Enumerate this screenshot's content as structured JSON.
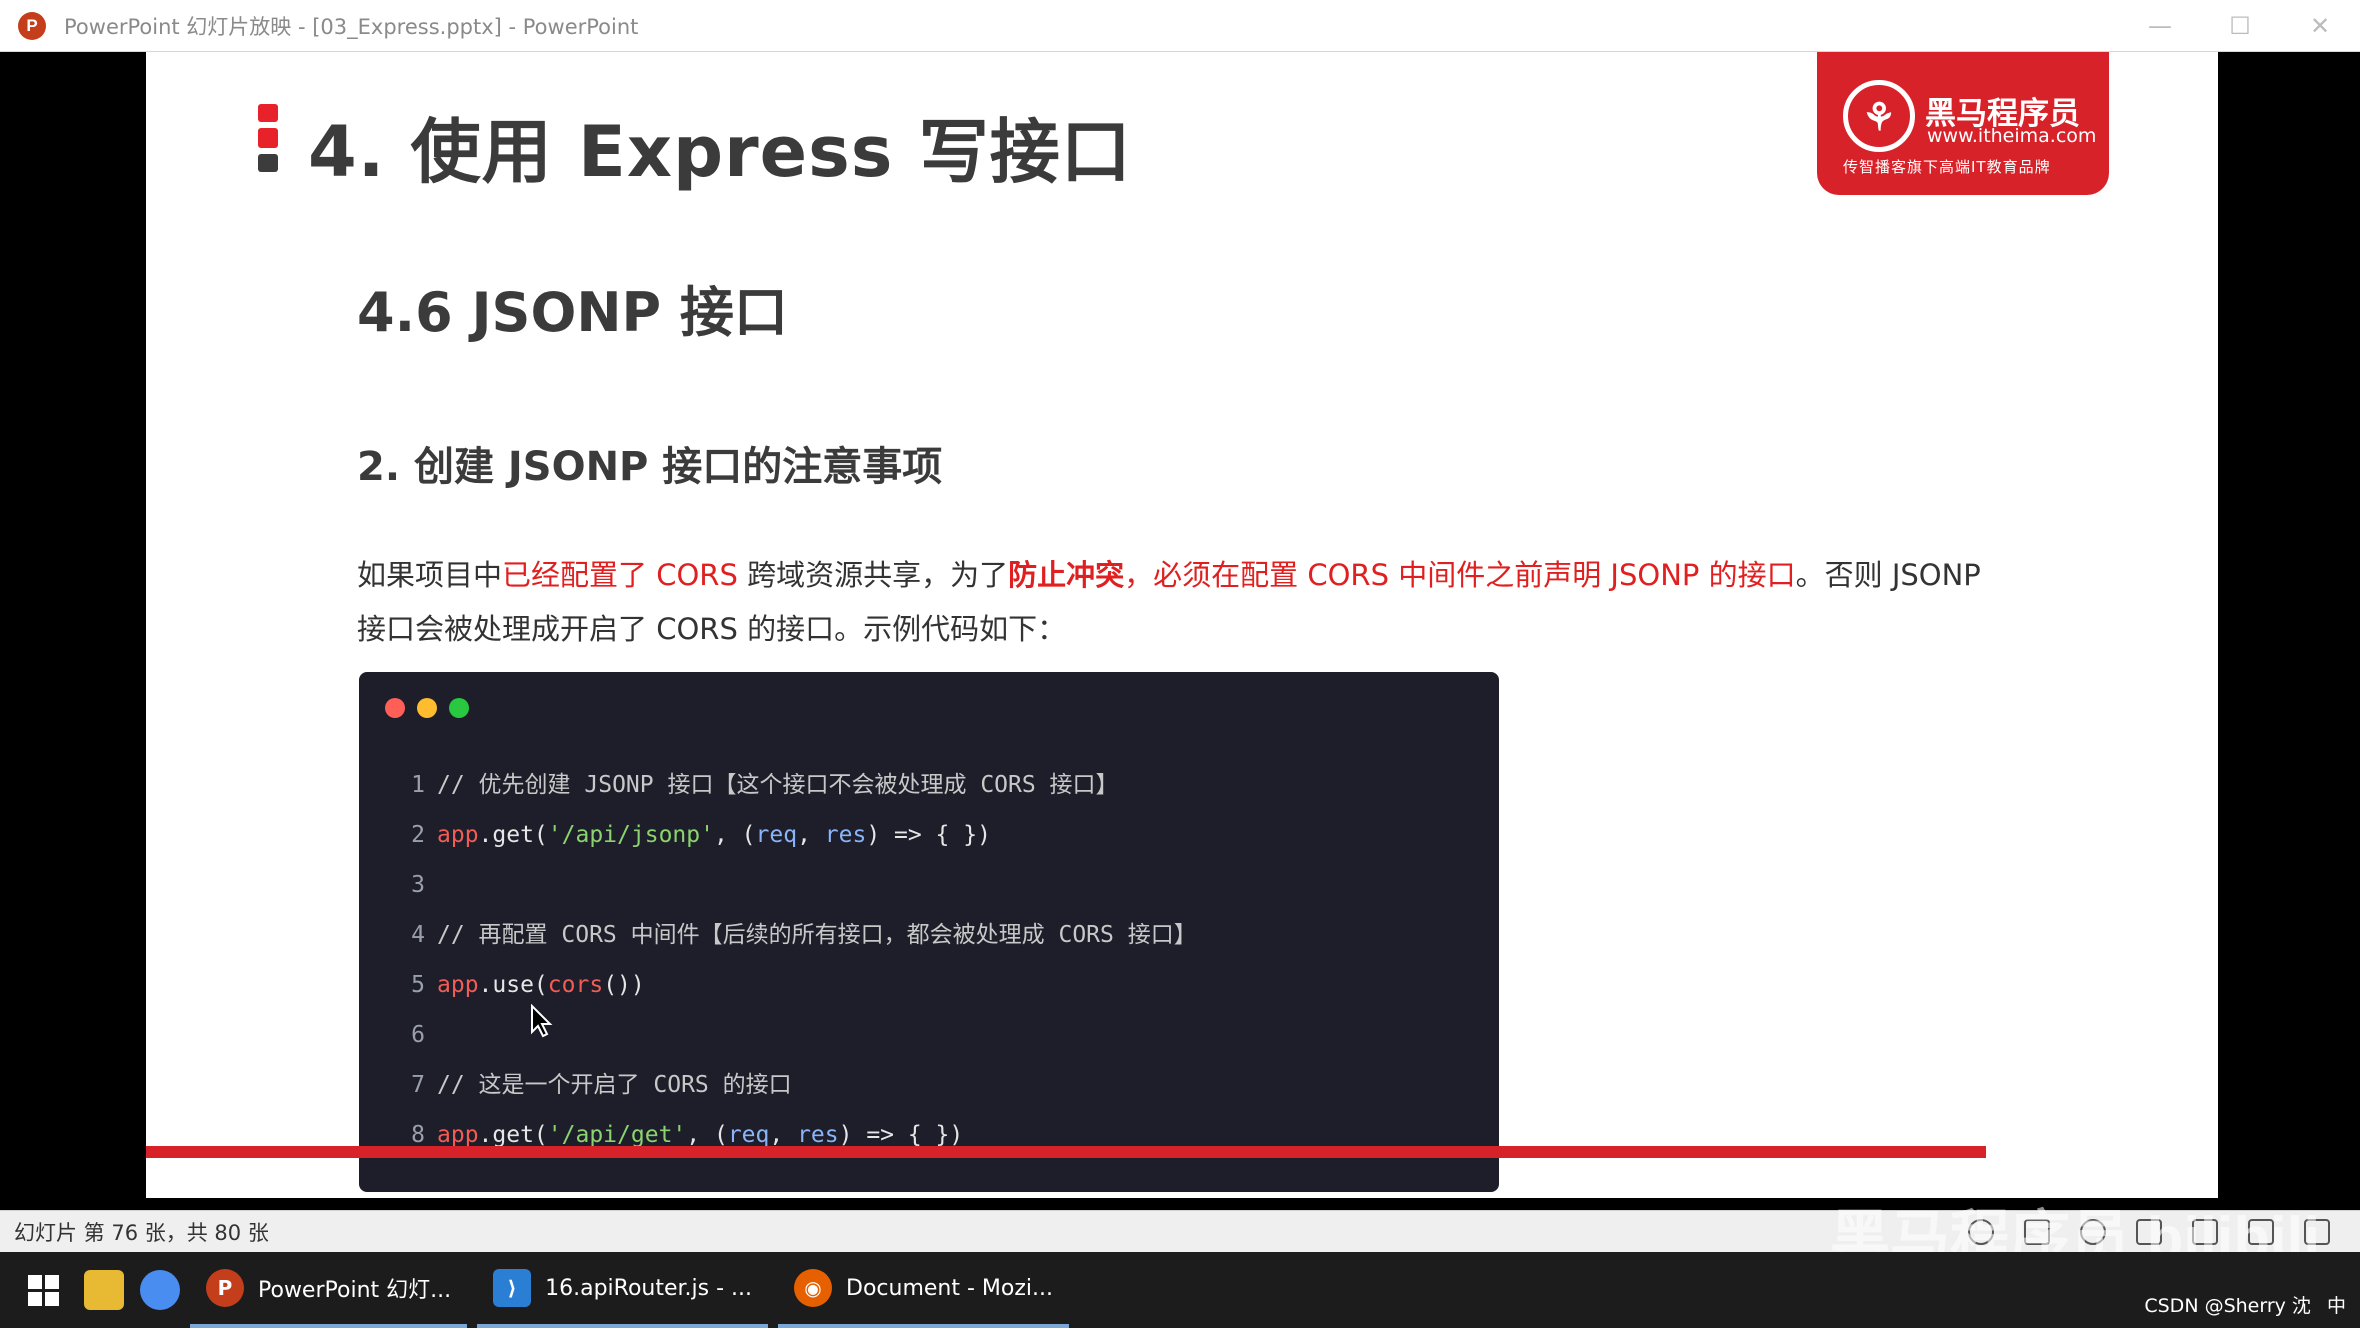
{
  "window": {
    "title": "PowerPoint 幻灯片放映 - [03_Express.pptx] - PowerPoint",
    "app_icon_letter": "P",
    "minimize": "—",
    "maximize": "☐",
    "close": "✕"
  },
  "slide": {
    "title": "4. 使用 Express 写接口",
    "logo": {
      "emblem": "⚘",
      "name": "黑马程序员",
      "url": "www.itheima.com",
      "slogan": "传智播客旗下高端IT教育品牌"
    },
    "section_title": "4.6 JSONP 接口",
    "sub_title": "2. 创建 JSONP 接口的注意事项",
    "paragraph": {
      "p1": "如果项目中",
      "p2": "已经配置了 CORS",
      "p3": " 跨域资源共享，为了",
      "p4": "防止冲突",
      "p5": "，",
      "p6": "必须在配置 CORS 中间件之前声明 JSONP 的接口",
      "p7": "。否则 JSONP 接口会被处理成开启了 CORS 的接口。示例代码如下："
    },
    "code": {
      "line1": {
        "num": "1",
        "comment": "// 优先创建 JSONP 接口【这个接口不会被处理成 CORS 接口】"
      },
      "line2": {
        "num": "2",
        "obj": "app",
        "mid": ".get(",
        "str": "'/api/jsonp'",
        "rest1": ", (",
        "p1": "req",
        "sep": ", ",
        "p2": "res",
        "rest2": ") => { })"
      },
      "line3": {
        "num": "3"
      },
      "line4": {
        "num": "4",
        "comment": "// 再配置 CORS 中间件【后续的所有接口，都会被处理成 CORS 接口】"
      },
      "line5": {
        "num": "5",
        "obj": "app",
        "mid": ".use(",
        "fn": "cors",
        "rest": "())"
      },
      "line6": {
        "num": "6"
      },
      "line7": {
        "num": "7",
        "comment": "// 这是一个开启了 CORS 的接口"
      },
      "line8": {
        "num": "8",
        "obj": "app",
        "mid": ".get(",
        "str": "'/api/get'",
        "rest1": ", (",
        "p1": "req",
        "sep": ", ",
        "p2": "res",
        "rest2": ") => { })"
      }
    }
  },
  "statusbar": {
    "text": "幻灯片 第 76 张，共 80 张"
  },
  "taskbar": {
    "apps": [
      {
        "label": "PowerPoint 幻灯...",
        "icon": "P",
        "color": "#c43e1c"
      },
      {
        "label": "16.apiRouter.js - ...",
        "icon": "⟩",
        "color": "#2a7fd4"
      },
      {
        "label": "Document - Mozi...",
        "icon": "◉",
        "color": "#e66000"
      }
    ],
    "tray_text": "CSDN @Sherry 沈",
    "ime": "中"
  },
  "watermark": "黑马程序员 bilibili"
}
